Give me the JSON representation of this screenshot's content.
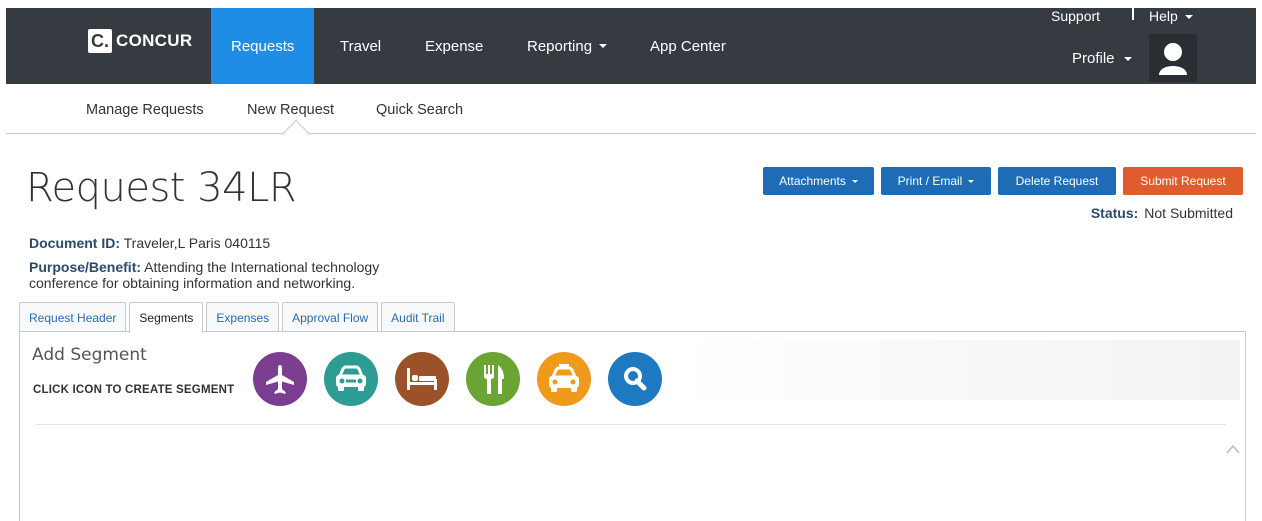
{
  "app": {
    "logo_mark": "C.",
    "logo_text": "CONCUR"
  },
  "nav": {
    "items": [
      {
        "label": "Requests",
        "active": true
      },
      {
        "label": "Travel"
      },
      {
        "label": "Expense"
      },
      {
        "label": "Reporting"
      },
      {
        "label": "App Center"
      }
    ]
  },
  "util": {
    "support": "Support",
    "help": "Help",
    "profile": "Profile"
  },
  "subnav": {
    "manage": "Manage Requests",
    "new": "New Request",
    "quick": "Quick Search"
  },
  "request": {
    "title": "Request 34LR",
    "doc_id_label": "Document ID:",
    "doc_id_value": "Traveler,L Paris 040115",
    "purpose_label": "Purpose/Benefit:",
    "purpose_value": "Attending the International technology conference for obtaining information and networking.",
    "status_label": "Status:",
    "status_value": "Not Submitted"
  },
  "actions": {
    "attachments": "Attachments",
    "print_email": "Print / Email",
    "delete": "Delete Request",
    "submit": "Submit Request"
  },
  "tabs": [
    "Request Header",
    "Segments",
    "Expenses",
    "Approval Flow",
    "Audit Trail"
  ],
  "segment_panel": {
    "title": "Add Segment",
    "hint": "CLICK ICON TO CREATE SEGMENT",
    "icons": [
      {
        "name": "airplane-icon",
        "color": "#7a3d8f"
      },
      {
        "name": "car-icon",
        "color": "#2d9c95"
      },
      {
        "name": "hotel-icon",
        "color": "#9b5229"
      },
      {
        "name": "dining-icon",
        "color": "#6aa534"
      },
      {
        "name": "taxi-icon",
        "color": "#f09a1d"
      },
      {
        "name": "search-icon",
        "color": "#1d7ac0"
      }
    ]
  },
  "colors": {
    "nav_bg": "#363b42",
    "nav_active": "#1f8ce6",
    "btn_blue": "#1d6cb5",
    "btn_red": "#e05c2f"
  }
}
